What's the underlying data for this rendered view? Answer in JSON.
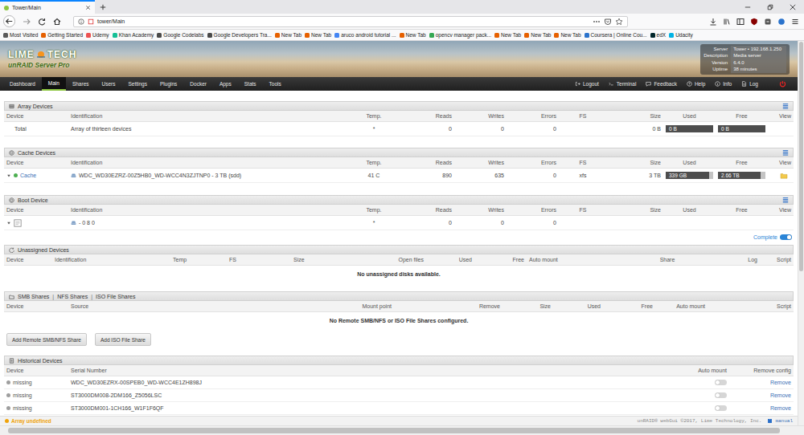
{
  "browser": {
    "tab": {
      "title": "Tower/Main",
      "selected": true
    },
    "url": "tower/Main"
  },
  "bookmarks": [
    {
      "label": "Most Visited",
      "color": "#5a5a5a"
    },
    {
      "label": "Getting Started",
      "color": "#e66000"
    },
    {
      "label": "Udemy",
      "color": "#ec5252"
    },
    {
      "label": "Khan Academy",
      "color": "#14bf96"
    },
    {
      "label": "Google Codelabs",
      "color": "#4a4a4a"
    },
    {
      "label": "Google Developers Tra...",
      "color": "#4a4a4a"
    },
    {
      "label": "New Tab",
      "color": "#e66000"
    },
    {
      "label": "New Tab",
      "color": "#e66000"
    },
    {
      "label": "aruco android tutorial ...",
      "color": "#4285f4"
    },
    {
      "label": "New Tab",
      "color": "#e66000"
    },
    {
      "label": "opencv manager pack...",
      "color": "#34a853"
    },
    {
      "label": "New Tab",
      "color": "#e66000"
    },
    {
      "label": "New Tab",
      "color": "#e66000"
    },
    {
      "label": "New Tab",
      "color": "#e66000"
    },
    {
      "label": "Coursera | Online Cou...",
      "color": "#2a73cc"
    },
    {
      "label": "edX",
      "color": "#02262b"
    },
    {
      "label": "Udacity",
      "color": "#02b3e4"
    }
  ],
  "brand": {
    "left": "LIME",
    "right": "TECH",
    "product": "unRAID Server Pro"
  },
  "server_info": [
    {
      "label": "Server",
      "value": "Tower • 192.168.1.250"
    },
    {
      "label": "Description",
      "value": "Media server"
    },
    {
      "label": "Version",
      "value": "6.4.0"
    },
    {
      "label": "Uptime",
      "value": "38 minutes"
    }
  ],
  "menu": [
    {
      "label": "Dashboard",
      "selected": false
    },
    {
      "label": "Main",
      "selected": true
    },
    {
      "label": "Shares",
      "selected": false
    },
    {
      "label": "Users",
      "selected": false
    },
    {
      "label": "Settings",
      "selected": false
    },
    {
      "label": "Plugins",
      "selected": false
    },
    {
      "label": "Docker",
      "selected": false
    },
    {
      "label": "Apps",
      "selected": false
    },
    {
      "label": "Stats",
      "selected": false
    },
    {
      "label": "Tools",
      "selected": false
    }
  ],
  "menu_right": [
    {
      "label": "Logout"
    },
    {
      "label": "Terminal"
    },
    {
      "label": "Feedback"
    },
    {
      "label": "Help"
    },
    {
      "label": "Info"
    },
    {
      "label": "Log"
    }
  ],
  "sections": [
    {
      "kind": "disks",
      "title": "Array Devices",
      "view_toggle": true,
      "columns": [
        "Device",
        "Identification",
        "Temp.",
        "Reads",
        "Writes",
        "Errors",
        "FS",
        "Size",
        "Used",
        "Free",
        "View"
      ],
      "rows": [
        {
          "cells": [
            {
              "kind": "text",
              "text": "Total"
            },
            {
              "kind": "text",
              "text": "Array of thirteen devices"
            },
            {
              "kind": "text",
              "text": "*"
            },
            {
              "kind": "text",
              "text": "0"
            },
            {
              "kind": "text",
              "text": "0"
            },
            {
              "kind": "text",
              "text": "0"
            },
            {
              "kind": "empty"
            },
            {
              "kind": "text",
              "text": "0 B"
            },
            {
              "kind": "bar",
              "text": "0 B",
              "level": 1
            },
            {
              "kind": "bar",
              "text": "0 B",
              "level": 1
            },
            {
              "kind": "empty"
            }
          ]
        }
      ]
    },
    {
      "kind": "disks",
      "title": "Cache Devices",
      "view_toggle": true,
      "columns": [
        "Device",
        "Identification",
        "Temp.",
        "Reads",
        "Writes",
        "Errors",
        "FS",
        "Size",
        "Used",
        "Free",
        "View"
      ],
      "rows": [
        {
          "cells": [
            {
              "kind": "device",
              "text": "Cache",
              "status_color": "#4caf50",
              "expandable": true
            },
            {
              "kind": "disk",
              "text": "WDC_WD30EZRZ-00Z5HB0_WD-WCC4N3ZJTNP0 - 3 TB (sdd)"
            },
            {
              "kind": "text",
              "text": "41 C"
            },
            {
              "kind": "text",
              "text": "890"
            },
            {
              "kind": "text",
              "text": "635"
            },
            {
              "kind": "text",
              "text": "0"
            },
            {
              "kind": "text",
              "text": "xfs"
            },
            {
              "kind": "text",
              "text": "3 TB"
            },
            {
              "kind": "bar",
              "text": "339 GB",
              "level": 0.92
            },
            {
              "kind": "bar",
              "text": "2.66 TB",
              "level": 0.9
            },
            {
              "kind": "folder"
            }
          ]
        }
      ]
    },
    {
      "kind": "disks",
      "title": "Boot Device",
      "view_toggle": true,
      "columns": [
        "Device",
        "Identification",
        "Temp.",
        "Reads",
        "Writes",
        "Errors",
        "FS",
        "Size",
        "Used",
        "Free",
        "View"
      ],
      "rows": [
        {
          "cells": [
            {
              "kind": "boot",
              "expandable": true
            },
            {
              "kind": "disk",
              "text": "- 0 8 0"
            },
            {
              "kind": "text",
              "text": "*"
            },
            {
              "kind": "text",
              "text": "0"
            },
            {
              "kind": "text",
              "text": "0"
            },
            {
              "kind": "text",
              "text": "0"
            },
            {
              "kind": "empty"
            },
            {
              "kind": "empty"
            },
            {
              "kind": "empty"
            },
            {
              "kind": "empty"
            },
            {
              "kind": "empty"
            }
          ]
        }
      ],
      "toggle": {
        "label": "Complete",
        "on": true
      }
    },
    {
      "kind": "unassigned",
      "title": "Unassigned Devices",
      "view_toggle": false,
      "columns": [
        "Device",
        "Identification",
        "Temp",
        "FS",
        "Size",
        "Open files",
        "Used",
        "Free",
        "Auto mount",
        "Share",
        "Log",
        "Script"
      ],
      "rows": [],
      "empty_message": "No unassigned disks available."
    },
    {
      "kind": "shares",
      "tabs": [
        "SMB Shares",
        "NFS Shares",
        "ISO File Shares"
      ],
      "separator": "|",
      "view_toggle": false,
      "columns": [
        "Device",
        "Source",
        "Mount point",
        "Remove",
        "Size",
        "Used",
        "Free",
        "Auto mount",
        "Script"
      ],
      "rows": [],
      "empty_message": "No Remote SMB/NFS or ISO File Shares configured.",
      "buttons": [
        "Add Remote SMB/NFS Share",
        "Add ISO File Share"
      ]
    },
    {
      "kind": "history",
      "title": "Historical Devices",
      "view_toggle": false,
      "columns": [
        "Device",
        "Serial Number",
        "Auto mount",
        "Remove config"
      ],
      "rows": [
        {
          "cells": [
            {
              "kind": "device",
              "text": "missing",
              "status_color": "#9e9e9e",
              "expandable": false
            },
            {
              "kind": "text",
              "text": "WDC_WD30EZRX-00SPEB0_WD-WCC4E1ZH898J"
            },
            {
              "kind": "toggle",
              "on": false
            },
            {
              "kind": "link",
              "text": "Remove"
            }
          ]
        },
        {
          "cells": [
            {
              "kind": "device",
              "text": "missing",
              "status_color": "#9e9e9e",
              "expandable": false
            },
            {
              "kind": "text",
              "text": "ST3000DM008-2DM166_Z5056LSC"
            },
            {
              "kind": "toggle",
              "on": false
            },
            {
              "kind": "link",
              "text": "Remove"
            }
          ]
        },
        {
          "cells": [
            {
              "kind": "device",
              "text": "missing",
              "status_color": "#9e9e9e",
              "expandable": false
            },
            {
              "kind": "text",
              "text": "ST3000DM001-1CH166_W1F1F6QF"
            },
            {
              "kind": "toggle",
              "on": false
            },
            {
              "kind": "link",
              "text": "Remove"
            }
          ]
        }
      ]
    }
  ],
  "status_bar": {
    "array_state": "Array undefined",
    "color": "#f0a30a",
    "copyright": "unRAID® webGui ©2017, Lime Technology, Inc.",
    "manual": "manual"
  },
  "scrollbars": {
    "vertical_level": 0.6,
    "horizontal_level": 0.98
  }
}
